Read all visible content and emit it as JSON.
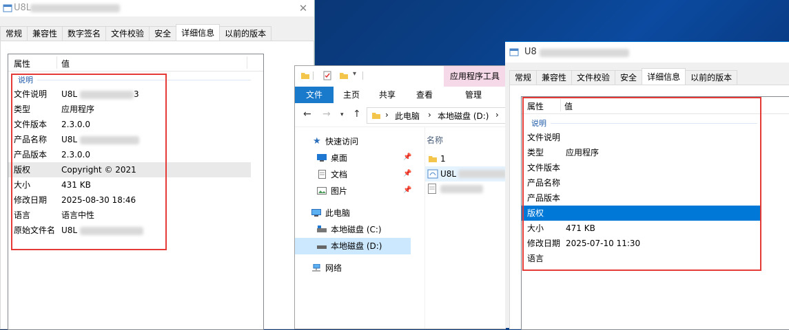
{
  "left_dialog": {
    "title": "U8L",
    "tabs": [
      "常规",
      "兼容性",
      "数字签名",
      "文件校验",
      "安全",
      "详细信息",
      "以前的版本"
    ],
    "active_tab": "详细信息",
    "header": {
      "property": "属性",
      "value": "值"
    },
    "group": "说明",
    "rows": [
      {
        "key": "文件说明",
        "value": "U8L",
        "tail": "3"
      },
      {
        "key": "类型",
        "value": "应用程序"
      },
      {
        "key": "文件版本",
        "value": "2.3.0.0"
      },
      {
        "key": "产品名称",
        "value": "U8L"
      },
      {
        "key": "产品版本",
        "value": "2.3.0.0"
      },
      {
        "key": "版权",
        "value": "Copyright ©  2021"
      },
      {
        "key": "大小",
        "value": "431 KB"
      },
      {
        "key": "修改日期",
        "value": "2025-08-30 18:46"
      },
      {
        "key": "语言",
        "value": "语言中性"
      },
      {
        "key": "原始文件名",
        "value": "U8L"
      }
    ]
  },
  "explorer": {
    "context_tab": "应用程序工具",
    "ribbon_tabs": [
      "文件",
      "主页",
      "共享",
      "查看",
      "管理"
    ],
    "breadcrumbs": [
      "此电脑",
      "本地磁盘 (D:)"
    ],
    "nav_items": [
      {
        "label": "快速访问",
        "icon": "star-icon"
      },
      {
        "label": "桌面",
        "icon": "desktop-icon",
        "pinned": true
      },
      {
        "label": "文档",
        "icon": "document-icon",
        "pinned": true
      },
      {
        "label": "图片",
        "icon": "picture-icon",
        "pinned": true
      },
      {
        "label": "此电脑",
        "icon": "computer-icon"
      },
      {
        "label": "本地磁盘 (C:)",
        "icon": "drive-icon"
      },
      {
        "label": "本地磁盘 (D:)",
        "icon": "drive-icon",
        "selected": true
      },
      {
        "label": "网络",
        "icon": "network-icon"
      }
    ],
    "column_header": "名称",
    "files": [
      {
        "name": "1",
        "icon": "folder-icon"
      },
      {
        "name": "U8L",
        "icon": "app-icon"
      },
      {
        "name": "",
        "icon": "file-icon"
      }
    ]
  },
  "right_dialog": {
    "title": "U8",
    "tabs": [
      "常规",
      "兼容性",
      "文件校验",
      "安全",
      "详细信息",
      "以前的版本"
    ],
    "active_tab": "详细信息",
    "header": {
      "property": "属性",
      "value": "值"
    },
    "group": "说明",
    "rows": [
      {
        "key": "文件说明",
        "value": ""
      },
      {
        "key": "类型",
        "value": "应用程序"
      },
      {
        "key": "文件版本",
        "value": ""
      },
      {
        "key": "产品名称",
        "value": ""
      },
      {
        "key": "产品版本",
        "value": ""
      },
      {
        "key": "版权",
        "value": ""
      },
      {
        "key": "大小",
        "value": "471 KB"
      },
      {
        "key": "修改日期",
        "value": "2025-07-10 11:30"
      },
      {
        "key": "语言",
        "value": ""
      }
    ],
    "selected_row": "版权"
  },
  "colors": {
    "selection": "#0078d7",
    "highlight_box": "#e53935",
    "file_tab": "#1979ca",
    "context_tab": "#f6d9e8"
  }
}
